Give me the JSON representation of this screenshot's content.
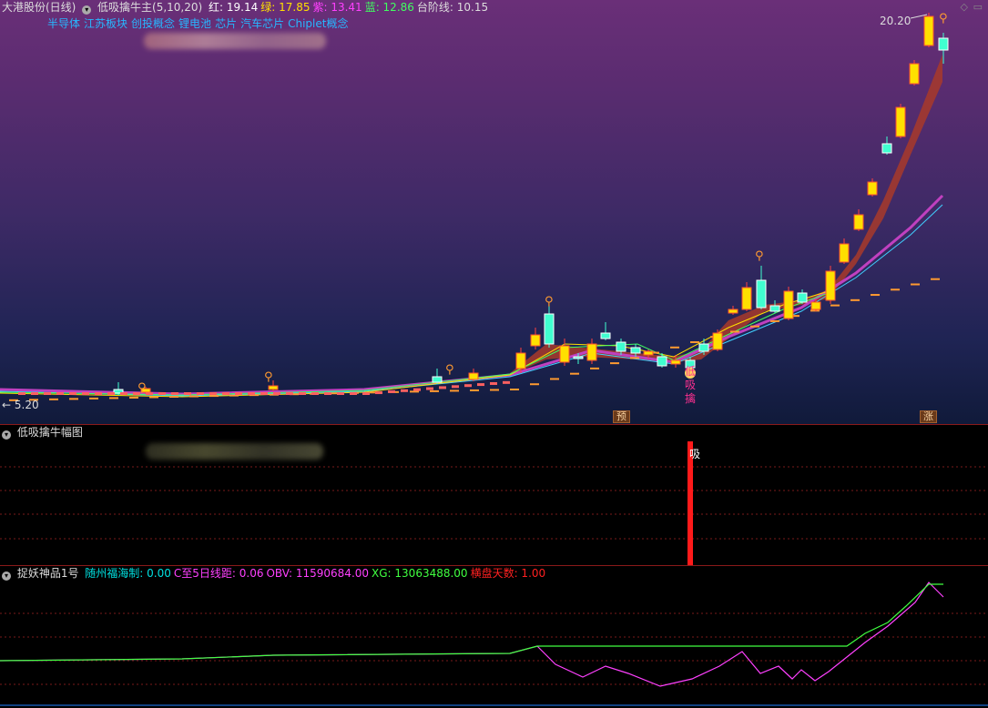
{
  "main": {
    "stock_name": "大港股份(日线)",
    "indicator_name": "低吸擒牛主(5,10,20)",
    "readouts": [
      {
        "label": "红:",
        "value": "19.14",
        "color": "#ffffff"
      },
      {
        "label": "绿:",
        "value": "17.85",
        "color": "#ffe000"
      },
      {
        "label": "紫:",
        "value": "13.41",
        "color": "#ff40ff"
      },
      {
        "label": "蓝:",
        "value": "12.86",
        "color": "#40ff60"
      },
      {
        "label": "台阶线:",
        "value": "10.15",
        "color": "#dddddd"
      }
    ],
    "concepts": [
      "半导体",
      "江苏板块",
      "创投概念",
      "锂电池",
      "芯片",
      "汽车芯片",
      "Chiplet概念"
    ],
    "high_label": "20.20",
    "low_label": "← 5.20",
    "buy_signal_text": [
      "低",
      "吸",
      "擒"
    ],
    "bottom_marks": [
      "预",
      "涨"
    ]
  },
  "osc": {
    "title": "低吸擒牛幅图",
    "signal_text": "吸"
  },
  "ind": {
    "title": "捉妖神品1号",
    "readouts": [
      {
        "label": "随州福海制:",
        "value": "0.00",
        "color": "#00e0e0"
      },
      {
        "label": "C至5日线距:",
        "value": "0.06",
        "color": "#ff40ff"
      },
      {
        "label": "OBV:",
        "value": "11590684.00",
        "color": "#ff40ff"
      },
      {
        "label": "XG:",
        "value": "13063488.00",
        "color": "#40ff40"
      },
      {
        "label": "横盘天数:",
        "value": "1.00",
        "color": "#ff2020"
      }
    ]
  },
  "colors": {
    "up_candle": "#ffe000",
    "down_candle": "#40ffd0",
    "ribbon": "#a83a2a",
    "step_line": "#ff9a30",
    "obv_line": "#ff40ff",
    "xg_line": "#40ff40",
    "signal_bar": "#ff1a1a"
  }
}
